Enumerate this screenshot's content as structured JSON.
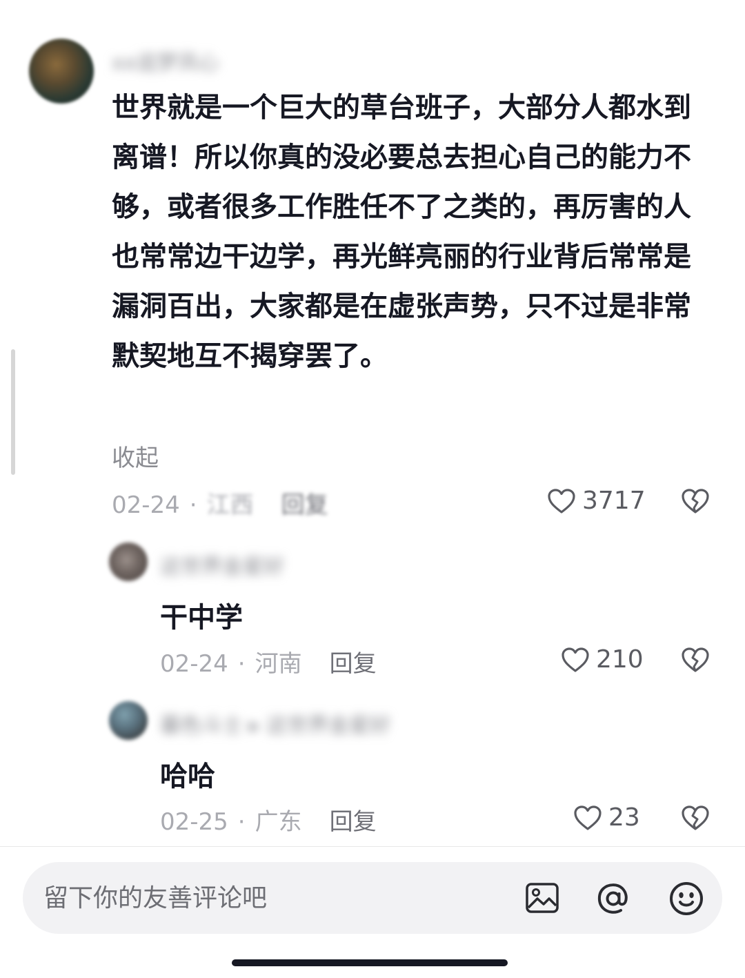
{
  "main_comment": {
    "username": "xx追梦凤心",
    "text": "世界就是一个巨大的草台班子，大部分人都水到离谱！所以你真的没必要总去担心自己的能力不够，或者很多工作胜任不了之类的，再厉害的人也常常边干边学，再光鲜亮丽的行业背后常常是漏洞百出，大家都是在虚张声势，只不过是非常默契地互不揭穿罢了。",
    "collapse_label": "收起",
    "date": "02-24",
    "location": "江西",
    "reply_label": "回复",
    "likes": "3717",
    "like_icon": "heart-outline-icon",
    "dislike_icon": "broken-heart-icon"
  },
  "replies": [
    {
      "username": "这世界金星好",
      "text": "干中学",
      "date": "02-24",
      "location": "河南",
      "reply_label": "回复",
      "likes": "210"
    },
    {
      "username": "暮色斗士 ▸ 这世界金星好",
      "text": "哈哈",
      "date": "02-25",
      "location": "广东",
      "reply_label": "回复",
      "likes": "23"
    }
  ],
  "separator": "·",
  "comment_bar": {
    "placeholder": "留下你的友善评论吧",
    "icons": [
      "image-icon",
      "at-icon",
      "emoji-icon"
    ]
  },
  "colors": {
    "primary_text": "#161823",
    "secondary_text": "#a9aab0",
    "input_background": "#f2f2f4"
  }
}
